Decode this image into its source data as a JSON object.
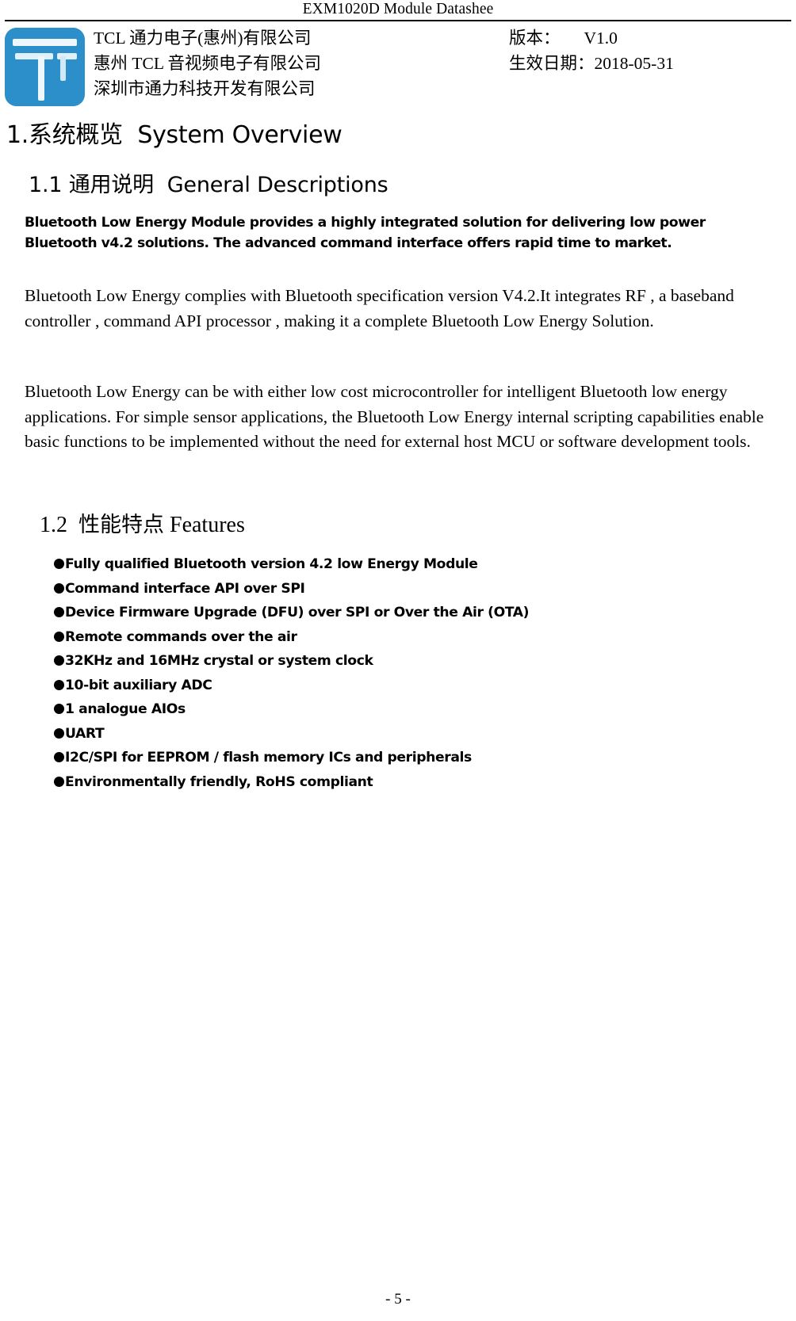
{
  "header": {
    "running_title": "EXM1020D Module Datashee",
    "logo_color": "#2d8fc9",
    "company_lines": [
      "TCL 通力电子(惠州)有限公司",
      "惠州 TCL 音视频电子有限公司",
      "深圳市通力科技开发有限公司"
    ],
    "version_label": "版本：",
    "version_value": "V1.0",
    "date_label": "生效日期：",
    "date_value": "2018-05-31"
  },
  "sections": {
    "h1": "1.系统概览  System Overview",
    "h1_number": "1.",
    "h1_cn": "系统概览",
    "h1_en": "System Overview",
    "s11_title": "1.1 通用说明  General Descriptions",
    "s11_number": "1.1",
    "s11_cn": "通用说明",
    "s11_en": "General Descriptions",
    "s12_number": "1.2",
    "s12_cn": "性能特点",
    "s12_en": "Features"
  },
  "paragraphs": {
    "p1": "Bluetooth Low Energy Module provides a highly integrated solution for delivering low power Bluetooth v4.2 solutions. The advanced command interface offers rapid time to market.",
    "p2": "Bluetooth Low Energy complies with Bluetooth specification version V4.2.It integrates RF , a baseband controller , command API processor , making it a complete Bluetooth Low Energy Solution.",
    "p3": "Bluetooth Low Energy can be with either low cost microcontroller for intelligent Bluetooth low energy applications. For simple sensor applications, the Bluetooth Low Energy internal scripting capabilities enable basic functions to be implemented without the need for external host MCU or software development tools."
  },
  "features": [
    "Fully qualified Bluetooth version 4.2 low Energy Module",
    "Command interface API over SPI",
    "Device Firmware Upgrade (DFU) over SPI or Over the Air (OTA)",
    "Remote commands over the air",
    "32KHz and 16MHz crystal or system clock",
    "10-bit auxiliary ADC",
    "1 analogue AIOs",
    "UART",
    "I2C/SPI for EEPROM / flash memory ICs and peripherals",
    "Environmentally friendly, RoHS compliant"
  ],
  "footer": {
    "page_number": "- 5 -"
  }
}
